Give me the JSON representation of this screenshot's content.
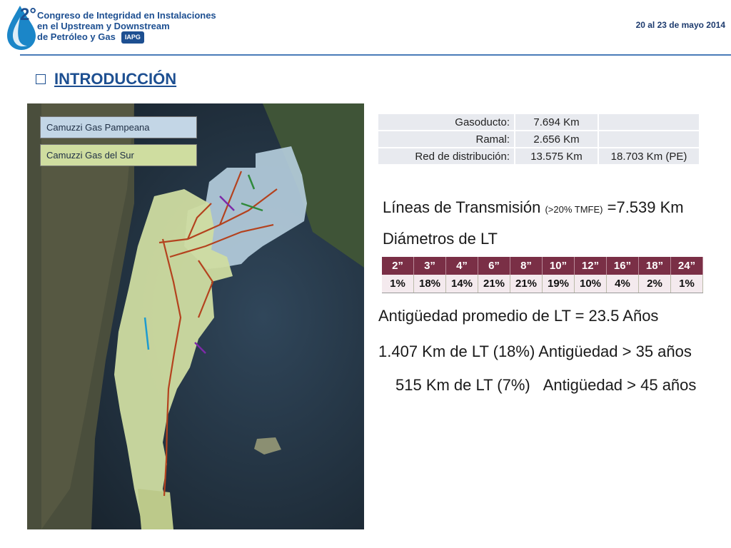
{
  "header": {
    "logo_number": "2°",
    "title_lines": [
      "Congreso de Integridad en Instalaciones",
      "en el Upstream y Downstream",
      "de Petróleo y Gas"
    ],
    "logo_badge": "IAPG",
    "date": "20 al 23 de mayo 2014"
  },
  "section_title": "INTRODUCCIÓN",
  "map": {
    "legend": [
      "Camuzzi Gas Pampeana",
      "Camuzzi Gas del Sur"
    ],
    "colors": {
      "pampeana": "#c3d6e6",
      "sur": "#cfdda0",
      "pipelines": "#b4421e"
    }
  },
  "summary_table": {
    "rows": [
      {
        "label": "Gasoducto:",
        "value": "7.694 Km",
        "extra": ""
      },
      {
        "label": "Ramal:",
        "value": "2.656 Km",
        "extra": ""
      },
      {
        "label": "Red de distribución:",
        "value": "13.575 Km",
        "extra": "18.703 Km (PE)"
      }
    ]
  },
  "transmission": {
    "prefix": "Líneas de Transmisión ",
    "qualifier": "(>20% TMFE)",
    "suffix": " =7.539 Km"
  },
  "diameters": {
    "title": "Diámetros de LT",
    "headers": [
      "2”",
      "3”",
      "4”",
      "6”",
      "8”",
      "10”",
      "12”",
      "16”",
      "18”",
      "24”"
    ],
    "values": [
      "1%",
      "18%",
      "14%",
      "21%",
      "21%",
      "19%",
      "10%",
      "4%",
      "2%",
      "1%"
    ]
  },
  "stats": {
    "average_age": "Antigüedad promedio de LT = 23.5 Años",
    "over35": "1.407 Km de LT (18%) Antigüedad > 35 años",
    "over45_km": "515 Km de LT (7%)",
    "over45_age": "Antigüedad > 45 años"
  }
}
